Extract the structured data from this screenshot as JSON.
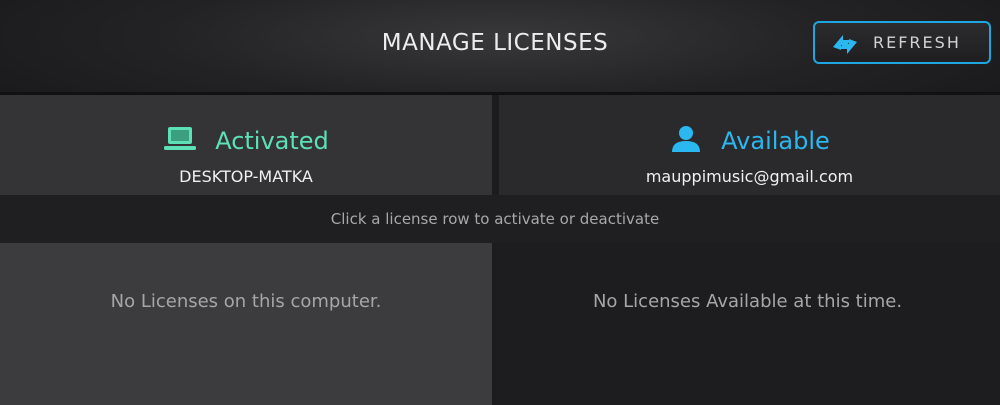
{
  "header": {
    "title": "MANAGE LICENSES",
    "refresh_label": "REFRESH",
    "refresh_icon": "refresh-arrows-icon"
  },
  "activated_panel": {
    "status": "Activated",
    "icon": "laptop-icon",
    "computer_name": "DESKTOP-MATKA",
    "empty_text": "No Licenses on this computer."
  },
  "available_panel": {
    "status": "Available",
    "icon": "user-icon",
    "account_email": "mauppimusic@gmail.com",
    "empty_text": "No Licenses Available at this time."
  },
  "hint": "Click a license row to activate or deactivate",
  "colors": {
    "accent_blue": "#1fa6e0",
    "activated_green": "#5de0b5",
    "available_blue": "#2bb7f0"
  }
}
